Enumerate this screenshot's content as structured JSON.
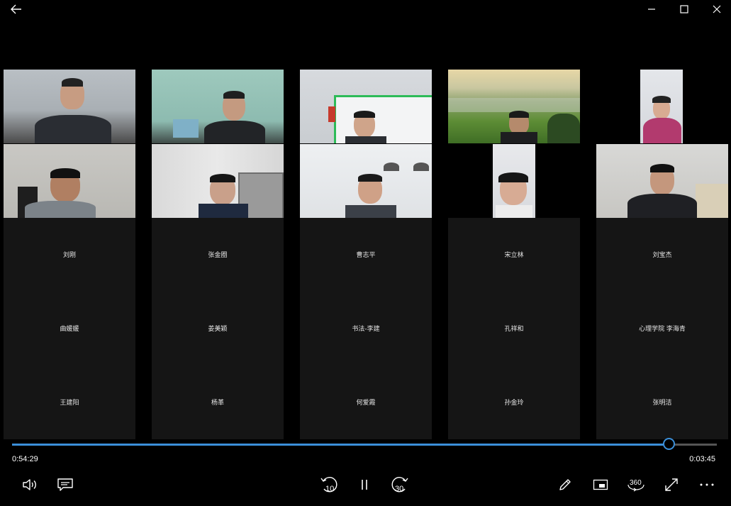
{
  "window": {
    "back_icon": "arrow-left-icon",
    "minimize_icon": "minimize-icon",
    "maximize_icon": "maximize-icon",
    "close_icon": "close-icon"
  },
  "video_tiles": [
    {
      "id": "v1",
      "scene": "office-man-dark-suit"
    },
    {
      "id": "v2",
      "scene": "office-man-green-wall"
    },
    {
      "id": "v3",
      "scene": "man-whiteboard"
    },
    {
      "id": "v4",
      "scene": "landscape-background-man"
    },
    {
      "id": "v5",
      "scene": "woman-pink-jacket"
    },
    {
      "id": "v6",
      "scene": "man-glasses-grey"
    },
    {
      "id": "v7",
      "scene": "man-glasses-bookshelf"
    },
    {
      "id": "v8",
      "scene": "man-glasses-suit"
    },
    {
      "id": "v9",
      "scene": "woman-glasses"
    },
    {
      "id": "v10",
      "scene": "man-office-bookshelf"
    }
  ],
  "name_rows": [
    [
      "刘刚",
      "张金圈",
      "曹志平",
      "宋立林",
      "刘宝杰"
    ],
    [
      "曲媛媛",
      "姜美颖",
      "书法-李建",
      "孔祥和",
      "心理学院 李海青"
    ],
    [
      "王建阳",
      "杨革",
      "何爱霞",
      "孙金玲",
      "张明洁"
    ]
  ],
  "player": {
    "elapsed": "0:54:29",
    "remaining": "0:03:45",
    "progress_fraction": 0.932,
    "controls_left": [
      "volume-icon",
      "subtitles-icon"
    ],
    "skip_back_label": "10",
    "skip_forward_label": "30",
    "controls_right": [
      "pen-icon",
      "mini-view-icon",
      "view-360-icon",
      "fullscreen-icon",
      "more-icon"
    ],
    "label_360": "360",
    "accent": "#3b8fd9"
  }
}
